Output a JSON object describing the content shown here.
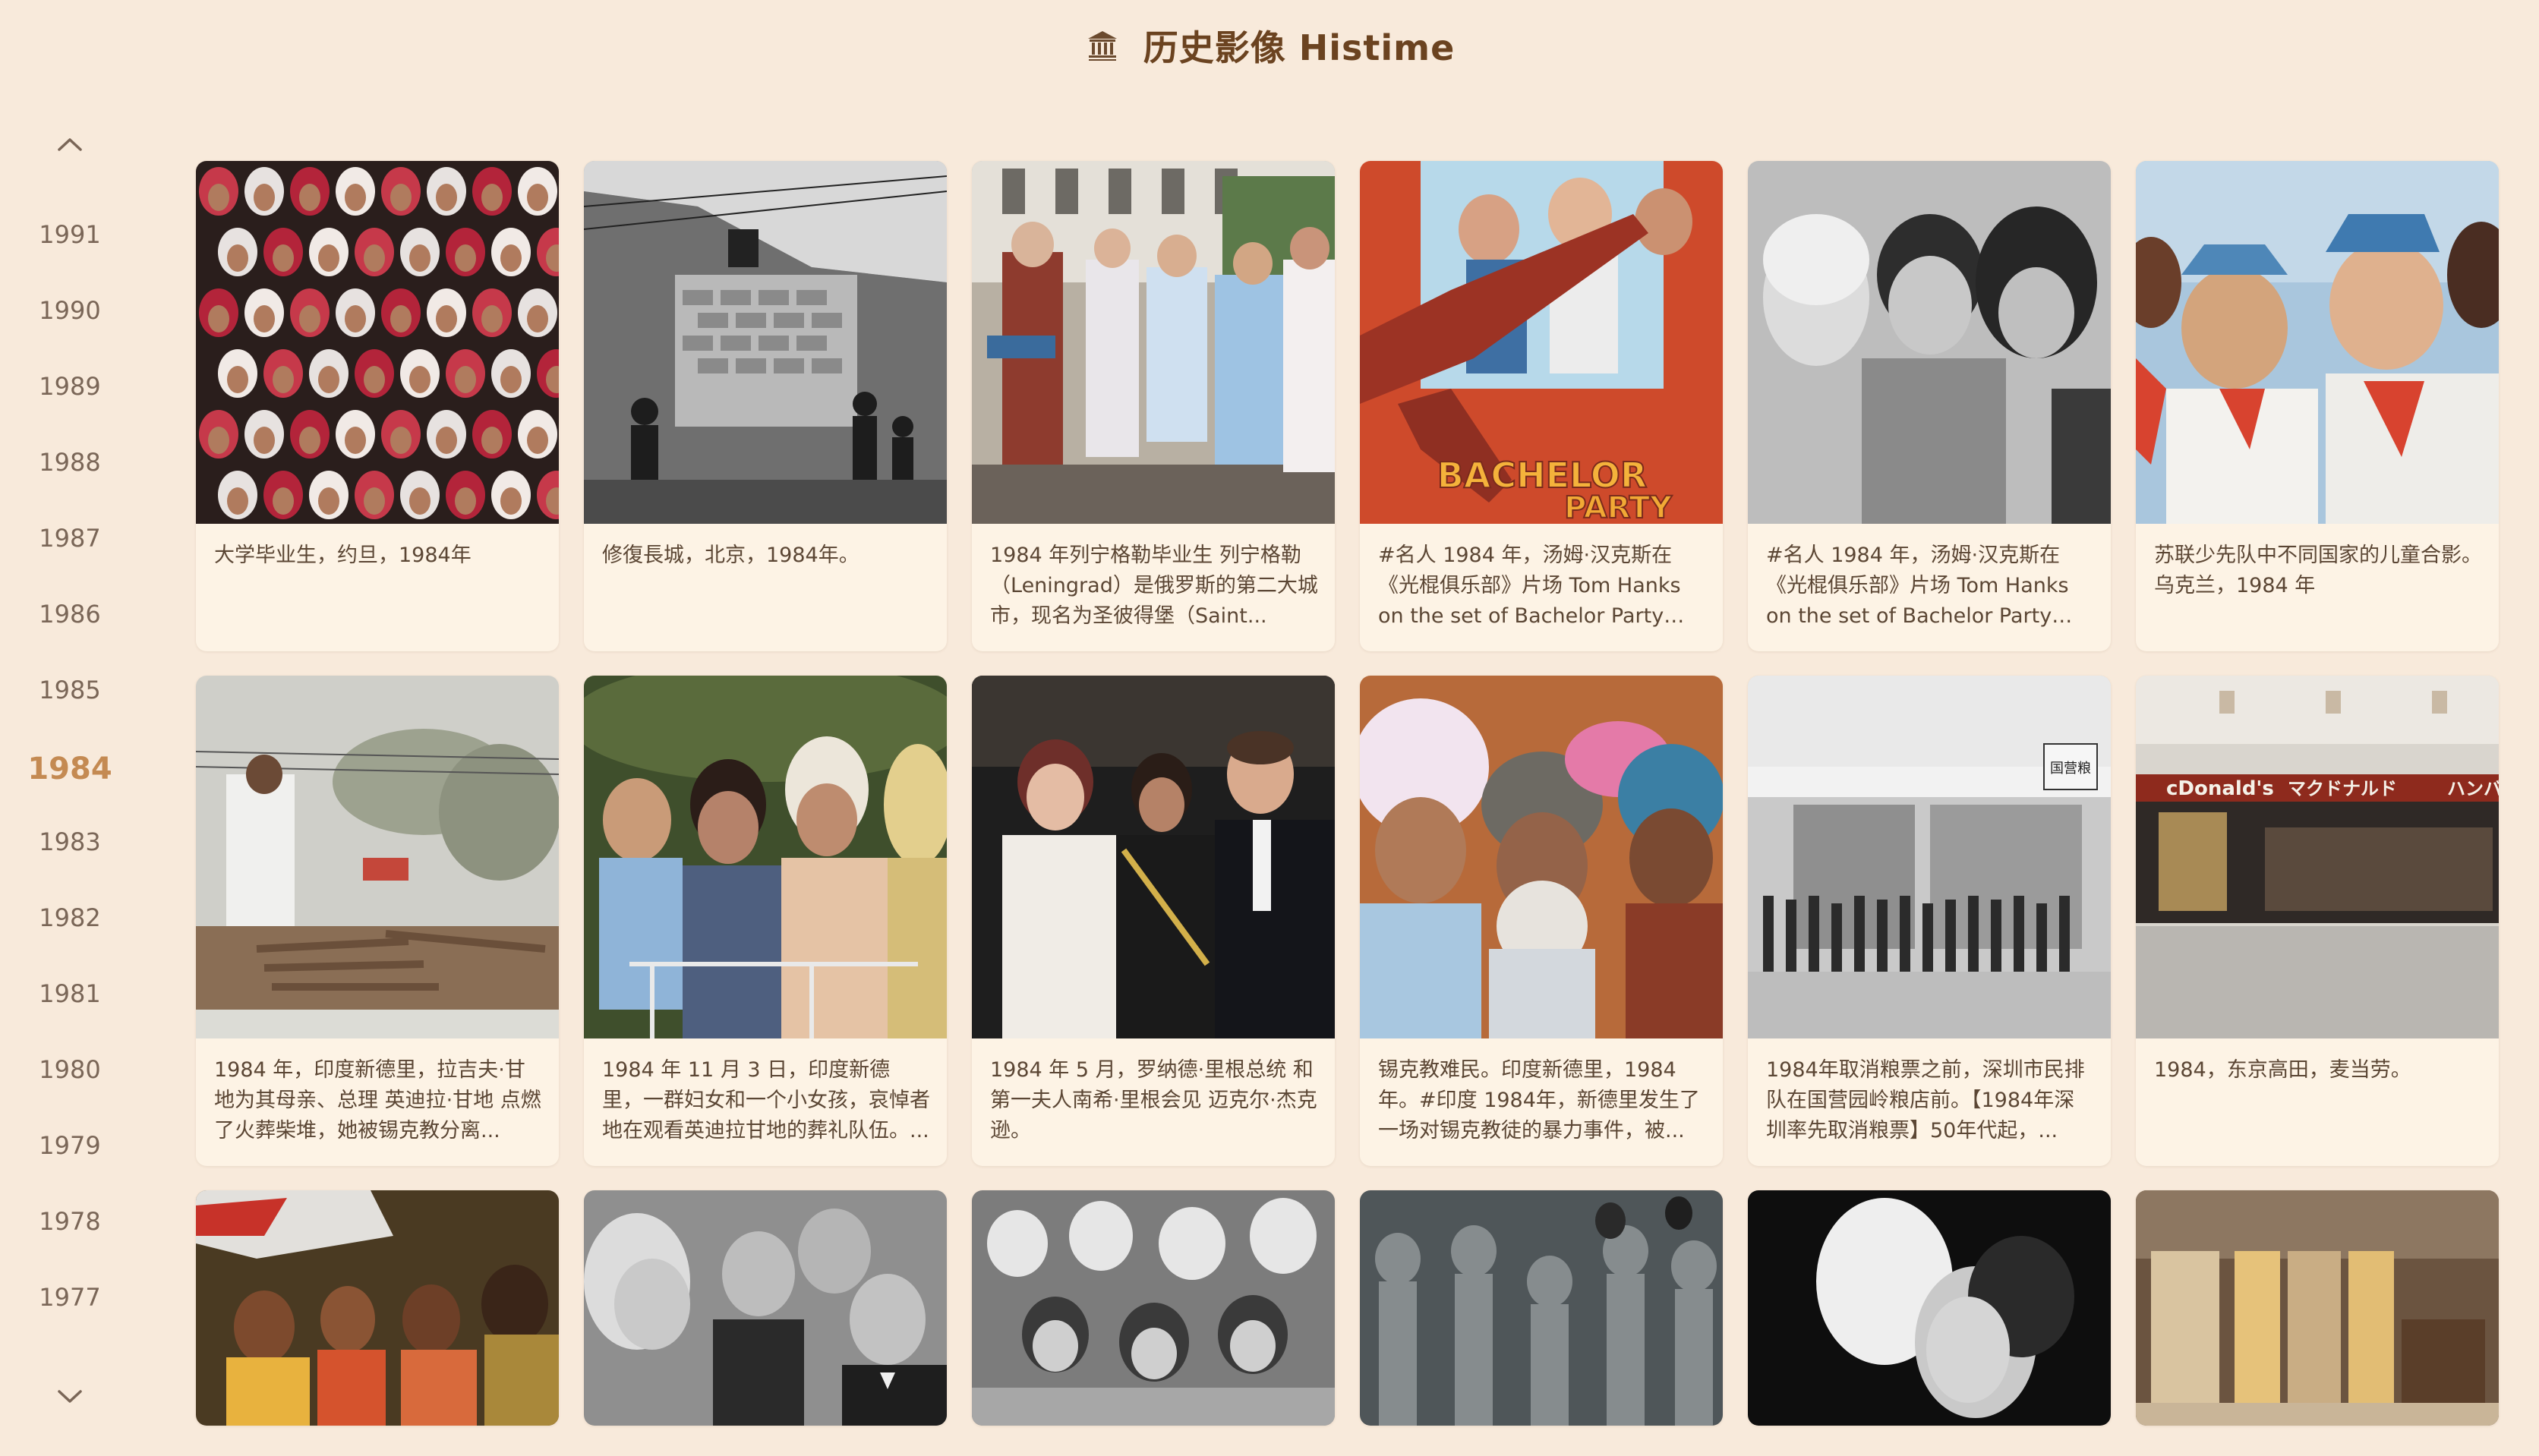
{
  "header": {
    "title": "历史影像 Histime",
    "logo_icon": "histime-logo-icon"
  },
  "sidebar": {
    "up_icon": "chevron-up-icon",
    "down_icon": "chevron-down-icon",
    "years": [
      "1991",
      "1990",
      "1989",
      "1988",
      "1987",
      "1986",
      "1985",
      "1984",
      "1983",
      "1982",
      "1981",
      "1980",
      "1979",
      "1978",
      "1977"
    ],
    "active_year": "1984"
  },
  "cards": [
    {
      "caption": "大学毕业生，约旦，1984年"
    },
    {
      "caption": "修復長城，北京，1984年。"
    },
    {
      "caption": "1984 年列宁格勒毕业生 列宁格勒（Leningrad）是俄罗斯的第二大城市，现名为圣彼得堡（Saint..."
    },
    {
      "caption": "#名人 1984 年，汤姆·汉克斯在《光棍俱乐部》片场 Tom Hanks on the set of Bachelor Party in..."
    },
    {
      "caption": "#名人 1984 年，汤姆·汉克斯在《光棍俱乐部》片场 Tom Hanks on the set of Bachelor Party in..."
    },
    {
      "caption": "苏联少先队中不同国家的儿童合影。乌克兰，1984 年"
    },
    {
      "caption": "1984 年，印度新德里，拉吉夫·甘地为其母亲、总理 英迪拉·甘地 点燃了火葬柴堆，她被锡克教分离..."
    },
    {
      "caption": "1984 年 11 月 3 日，印度新德里，一群妇女和一个小女孩，哀悼者地在观看英迪拉甘地的葬礼队伍。..."
    },
    {
      "caption": "1984 年 5 月，罗纳德·里根总统 和第一夫人南希·里根会见 迈克尔·杰克逊。"
    },
    {
      "caption": "锡克教难民。印度新德里，1984年。#印度 1984年，新德里发生了一场对锡克教徒的暴力事件，被..."
    },
    {
      "caption": "1984年取消粮票之前，深圳市民排队在国营园岭粮店前。【1984年深圳率先取消粮票】50年代起，..."
    },
    {
      "caption": "1984，东京高田，麦当劳。"
    },
    {
      "caption": ""
    },
    {
      "caption": ""
    },
    {
      "caption": ""
    },
    {
      "caption": ""
    },
    {
      "caption": ""
    },
    {
      "caption": ""
    }
  ],
  "overlay_text": {
    "bachelor": "BACHELOR",
    "party": "PARTY",
    "mcdonalds": "cDonald's",
    "mcd_jp": "マクドナルド",
    "mcd_jp2": "ハンバ",
    "store_sign": "国营粮"
  }
}
